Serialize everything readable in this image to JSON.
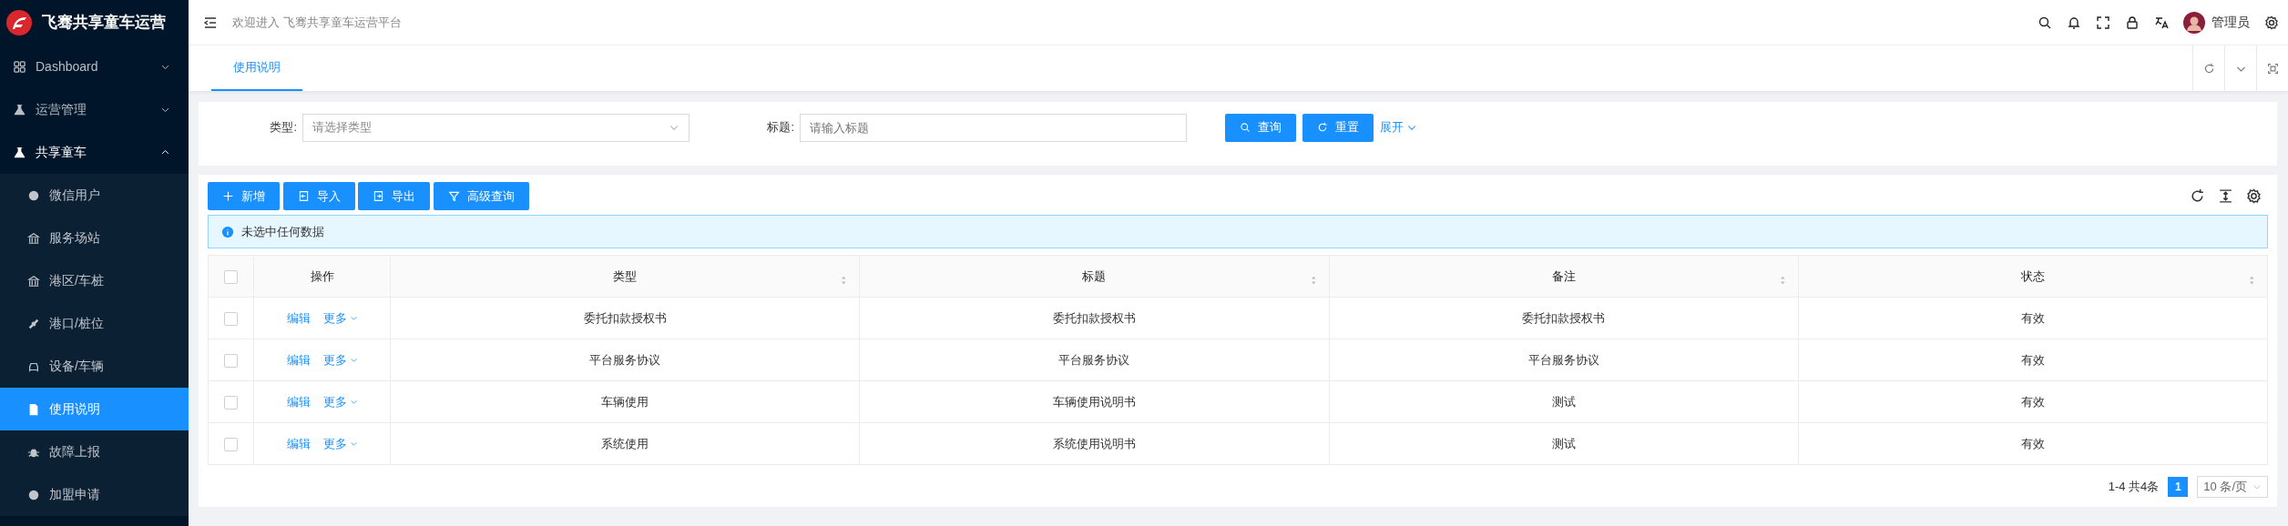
{
  "sidebar": {
    "logo_text": "飞骞共享童车运营",
    "items": [
      {
        "label": "Dashboard",
        "expanded": false
      },
      {
        "label": "运营管理",
        "expanded": false
      },
      {
        "label": "共享童车",
        "expanded": true,
        "children": [
          {
            "label": "微信用户",
            "selected": false
          },
          {
            "label": "服务场站",
            "selected": false
          },
          {
            "label": "港区/车桩",
            "selected": false
          },
          {
            "label": "港口/桩位",
            "selected": false
          },
          {
            "label": "设备/车辆",
            "selected": false
          },
          {
            "label": "使用说明",
            "selected": true
          },
          {
            "label": "故障上报",
            "selected": false
          },
          {
            "label": "加盟申请",
            "selected": false
          }
        ]
      }
    ]
  },
  "header": {
    "welcome": "欢迎进入 飞骞共享童车运营平台",
    "user": "管理员"
  },
  "tabs": [
    {
      "label": "使用说明",
      "selected": true
    }
  ],
  "filter": {
    "fields": [
      {
        "label": "类型:",
        "kind": "select",
        "placeholder": "请选择类型"
      },
      {
        "label": "标题:",
        "kind": "input",
        "placeholder": "请输入标题"
      }
    ],
    "buttons": [
      "查询",
      "重置"
    ],
    "expand_link": "展开"
  },
  "toolbar": {
    "buttons": [
      "新增",
      "导入",
      "导出",
      "高级查询"
    ]
  },
  "alert": "未选中任何数据",
  "table": {
    "all_checked": false,
    "action_column": "操作",
    "columns": [
      {
        "label": "类型",
        "sortable": true
      },
      {
        "label": "标题",
        "sortable": true
      },
      {
        "label": "备注",
        "sortable": true
      },
      {
        "label": "状态",
        "sortable": true
      }
    ],
    "rows": [
      {
        "checked": false,
        "actions": [
          "编辑",
          "更多"
        ],
        "cells": [
          "委托扣款授权书",
          "委托扣款授权书",
          "委托扣款授权书",
          "有效"
        ]
      },
      {
        "checked": false,
        "actions": [
          "编辑",
          "更多"
        ],
        "cells": [
          "平台服务协议",
          "平台服务协议",
          "平台服务协议",
          "有效"
        ]
      },
      {
        "checked": false,
        "actions": [
          "编辑",
          "更多"
        ],
        "cells": [
          "车辆使用",
          "车辆使用说明书",
          "测试",
          "有效"
        ]
      },
      {
        "checked": false,
        "actions": [
          "编辑",
          "更多"
        ],
        "cells": [
          "系统使用",
          "系统使用说明书",
          "测试",
          "有效"
        ]
      }
    ]
  },
  "pagination": {
    "summary": "1-4 共4条",
    "pages": [
      {
        "label": "1",
        "selected": true
      }
    ],
    "page_size": "10 条/页"
  }
}
